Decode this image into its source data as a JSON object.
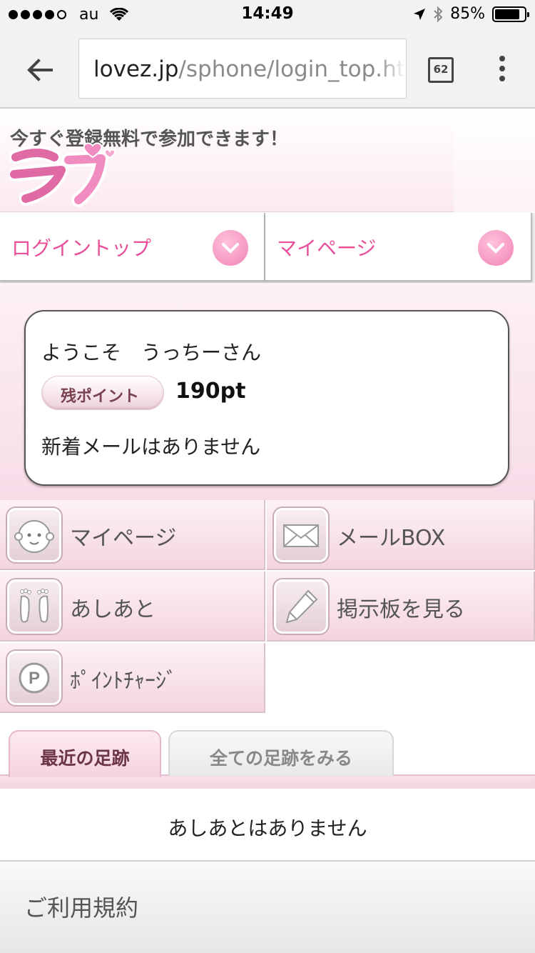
{
  "status_bar": {
    "carrier": "au",
    "time": "14:49",
    "battery": "85%"
  },
  "browser": {
    "url_domain": "lovez.jp",
    "url_path": "/sphone/login_top.htm",
    "tab_count": "62"
  },
  "header": {
    "tagline": "今すぐ登録無料で参加できます！",
    "logo_text": "ラブ"
  },
  "nav": {
    "items": [
      {
        "label": "ログイントップ"
      },
      {
        "label": "マイページ"
      }
    ]
  },
  "welcome": {
    "greeting": "ようこそ　うっちーさん",
    "points_label": "残ポイント",
    "points_value": "190pt",
    "mail_status": "新着メールはありません"
  },
  "menu": {
    "items": [
      {
        "label": "マイページ",
        "icon": "face-icon"
      },
      {
        "label": "メールBOX",
        "icon": "envelope-icon"
      },
      {
        "label": "あしあと",
        "icon": "footprints-icon"
      },
      {
        "label": "掲示板を見る",
        "icon": "pencil-icon"
      },
      {
        "label": "ﾎﾟｲﾝﾄﾁｬｰｼﾞ",
        "icon": "point-coin-icon"
      }
    ]
  },
  "footprints": {
    "tabs": [
      {
        "label": "最近の足跡",
        "active": true
      },
      {
        "label": "全ての足跡をみる",
        "active": false
      }
    ],
    "empty_message": "あしあとはありません"
  },
  "footer": {
    "terms_label": "ご利用規約"
  },
  "colors": {
    "accent_pink": "#e8509a",
    "menu_label": "#555555"
  }
}
